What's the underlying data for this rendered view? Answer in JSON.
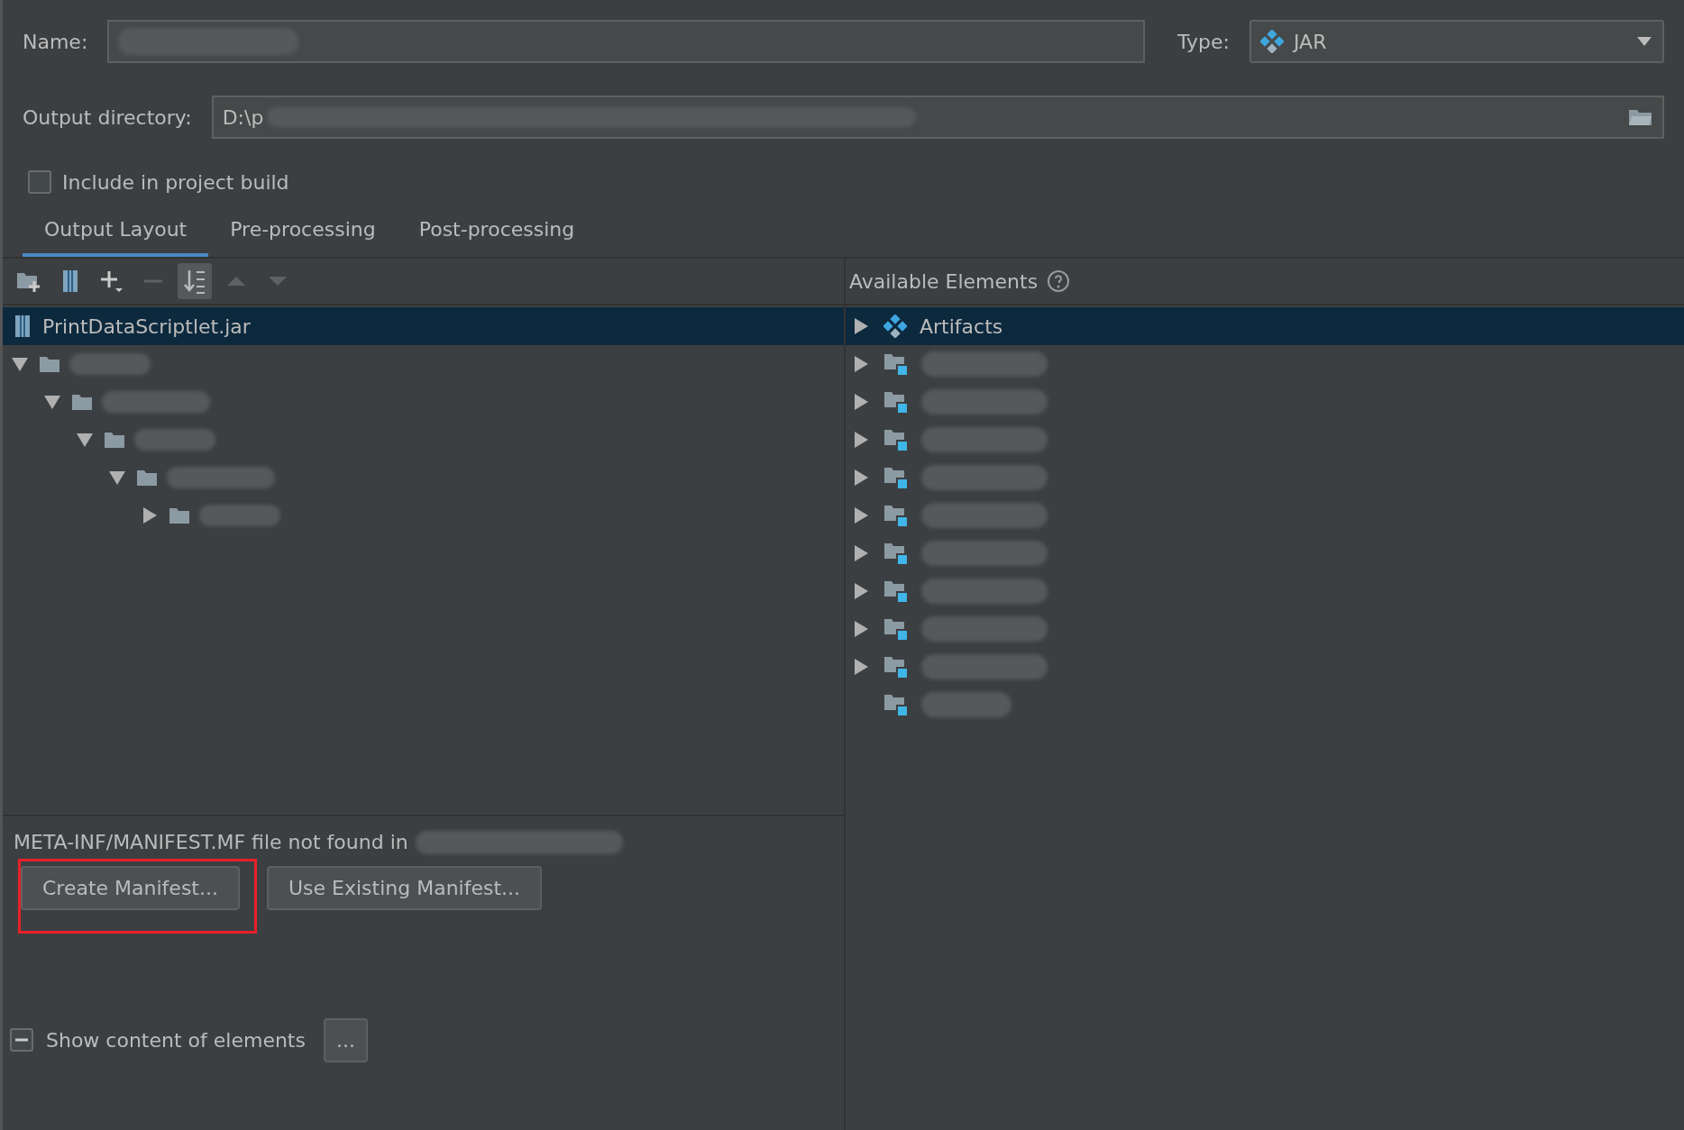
{
  "name_field": {
    "label": "Name:"
  },
  "type_field": {
    "label": "Type:",
    "value": "JAR"
  },
  "output_directory": {
    "label": "Output directory:",
    "value": "D:\\p"
  },
  "include_in_build": {
    "label": "Include in project build",
    "checked": false
  },
  "tabs": [
    {
      "label": "Output Layout",
      "selected": true
    },
    {
      "label": "Pre-processing",
      "selected": false
    },
    {
      "label": "Post-processing",
      "selected": false
    }
  ],
  "layout_tree": {
    "label": "PrintDataScriptlet.jar",
    "selected": true,
    "children": [
      {
        "expanded": true,
        "children": [
          {
            "expanded": true,
            "children": [
              {
                "expanded": true,
                "children": [
                  {
                    "expanded": true,
                    "children": [
                      {
                        "expanded": false
                      }
                    ]
                  }
                ]
              }
            ]
          }
        ]
      }
    ]
  },
  "available_elements": {
    "title": "Available Elements",
    "items": [
      {
        "kind": "artifacts",
        "label": "Artifacts",
        "selected": true,
        "expanded": false
      },
      {
        "kind": "module",
        "selected": false,
        "expanded": false
      },
      {
        "kind": "module",
        "selected": false,
        "expanded": false
      },
      {
        "kind": "module",
        "selected": false,
        "expanded": false
      },
      {
        "kind": "module",
        "selected": false,
        "expanded": false
      },
      {
        "kind": "module",
        "selected": false,
        "expanded": false
      },
      {
        "kind": "module",
        "selected": false,
        "expanded": false
      },
      {
        "kind": "module",
        "selected": false,
        "expanded": false
      },
      {
        "kind": "module",
        "selected": false,
        "expanded": false
      },
      {
        "kind": "module",
        "selected": false,
        "expanded": false
      },
      {
        "kind": "leaf",
        "selected": false
      }
    ]
  },
  "message": "META-INF/MANIFEST.MF file not found in",
  "manifest_buttons": [
    "Create Manifest...",
    "Use Existing Manifest..."
  ],
  "show_content": {
    "label": "Show content of elements",
    "indeterminate": true
  },
  "more_button": "..."
}
